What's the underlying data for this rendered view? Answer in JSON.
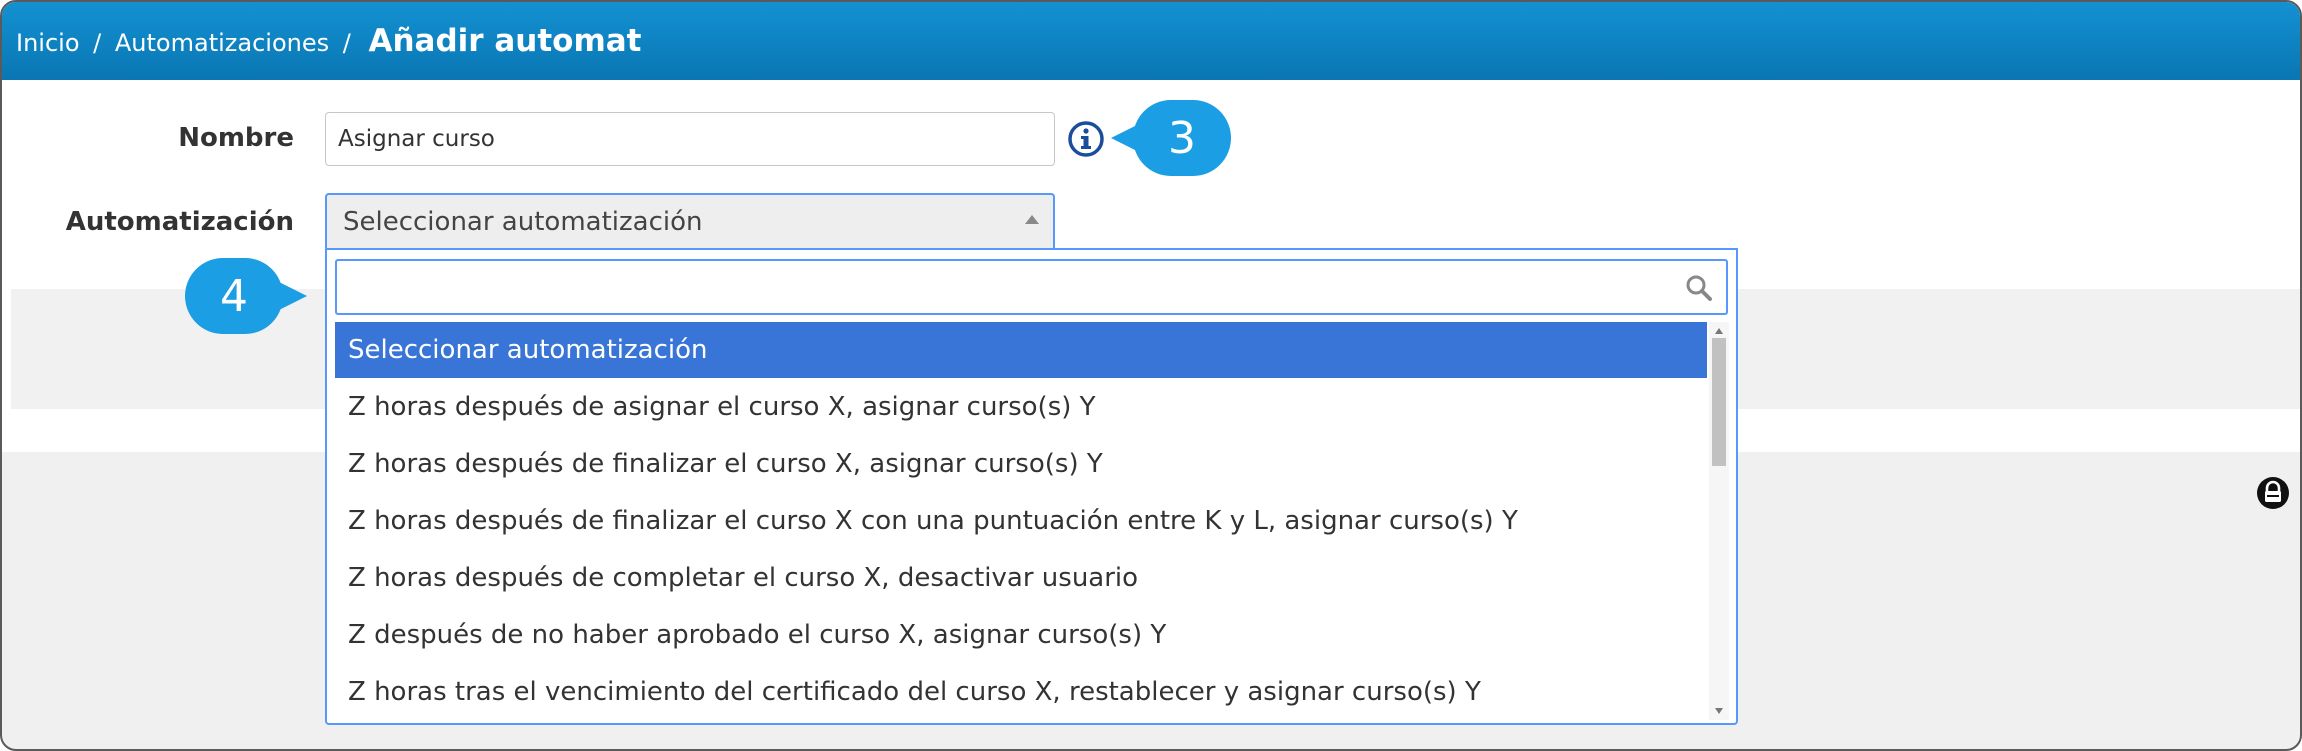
{
  "breadcrumb": {
    "home": "Inicio",
    "separator": "/",
    "section": "Automatizaciones",
    "current": "Añadir automat"
  },
  "form": {
    "name_label": "Nombre",
    "name_value": "Asignar curso",
    "automation_label": "Automatización",
    "automation_selected": "Seleccionar automatización"
  },
  "callouts": {
    "three": "3",
    "four": "4"
  },
  "dropdown": {
    "search_value": "",
    "options": [
      "Seleccionar automatización",
      "Z horas después de asignar el curso X, asignar curso(s) Y",
      "Z horas después de finalizar el curso X, asignar curso(s) Y",
      "Z horas después de finalizar el curso X con una puntuación entre K y L, asignar curso(s) Y",
      "Z horas después de completar el curso X, desactivar usuario",
      "Z después de no haber aprobado el curso X, asignar curso(s) Y",
      "Z horas tras el vencimiento del certificado del curso X, restablecer y asignar curso(s) Y"
    ],
    "selected_index": 0,
    "scroll_fraction": 0.0
  },
  "icons": {
    "info": "info-icon",
    "search": "search-icon",
    "lock": "lock-icon",
    "dropdown_arrow": "chevron-up-icon"
  },
  "colors": {
    "header_top": "#1391d2",
    "header_bottom": "#0a76b3",
    "callout": "#1b9ee4",
    "selection": "#3875d7",
    "focus_border": "#5897fb",
    "info_icon": "#1a4e9c"
  }
}
